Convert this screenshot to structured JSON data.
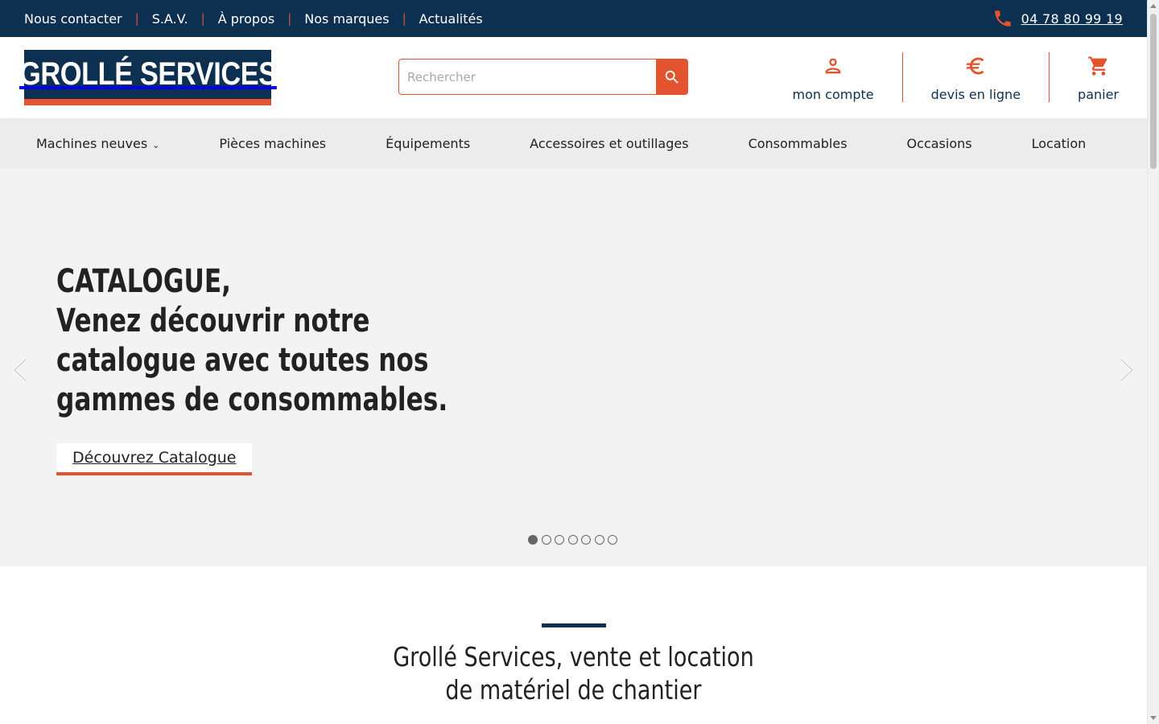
{
  "topbar": {
    "links": [
      {
        "label": "Nous contacter"
      },
      {
        "label": "S.A.V."
      },
      {
        "label": "À propos"
      },
      {
        "label": "Nos marques"
      },
      {
        "label": "Actualités"
      }
    ],
    "separator": "|",
    "phone": "04 78 80 99 19"
  },
  "header": {
    "logo_text": "GROLLÉ SERVICES",
    "search": {
      "placeholder": "Rechercher",
      "value": ""
    },
    "links": [
      {
        "label": "mon compte",
        "icon": "account-icon"
      },
      {
        "label": "devis en ligne",
        "icon": "euro-icon"
      },
      {
        "label": "panier",
        "icon": "cart-icon"
      }
    ]
  },
  "nav": {
    "items": [
      {
        "label": "Machines neuves",
        "has_dropdown": true
      },
      {
        "label": "Pièces machines"
      },
      {
        "label": "Équipements"
      },
      {
        "label": "Accessoires et outillages"
      },
      {
        "label": "Consommables"
      },
      {
        "label": "Occasions"
      },
      {
        "label": "Location"
      }
    ],
    "caret": "⌄"
  },
  "hero": {
    "title_lines": [
      "CATALOGUE,",
      "Venez découvrir notre",
      "catalogue avec toutes nos",
      "gammes de consommables."
    ],
    "cta_label": "Découvrez Catalogue",
    "slide_count": 7,
    "active_slide": 1
  },
  "section": {
    "title_lines": [
      "Grollé Services, vente et location",
      "de matériel de chantier"
    ]
  },
  "colors": {
    "navy": "#0d3050",
    "accent": "#e2532e",
    "nav_bg": "#ececec",
    "hero_bg": "#f3f3f3"
  }
}
